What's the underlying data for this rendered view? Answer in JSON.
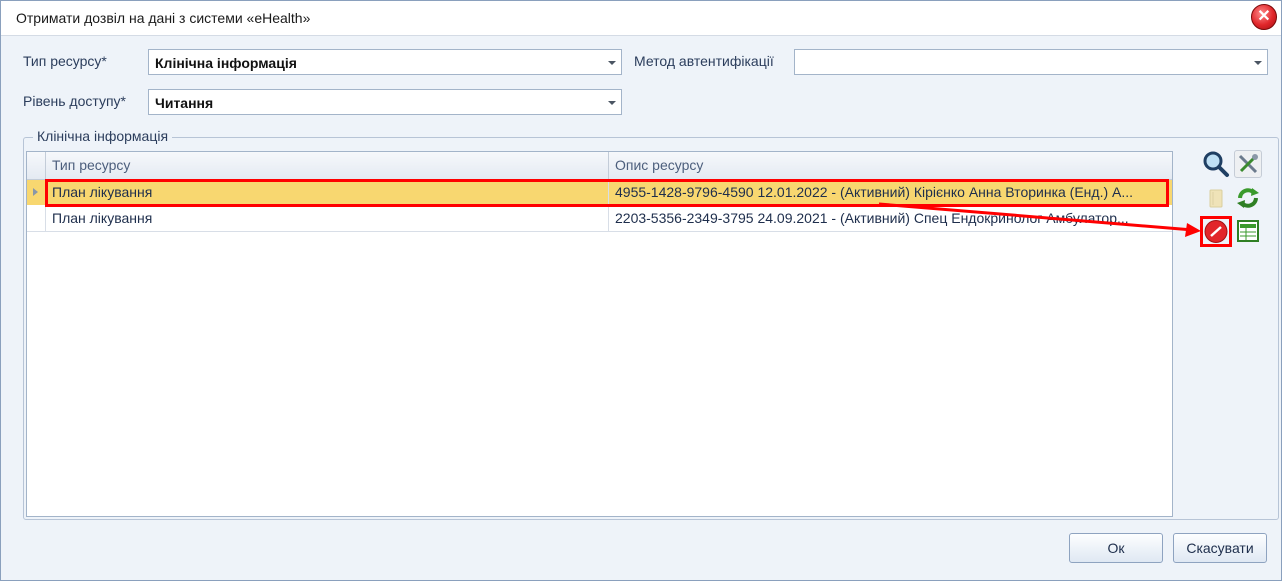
{
  "window": {
    "title": "Отримати дозвіл на дані з системи «eHealth»"
  },
  "form": {
    "resource_type_label": "Тип ресурсу*",
    "resource_type_value": "Клінічна інформація",
    "auth_method_label": "Метод автентифікації",
    "auth_method_value": "",
    "access_level_label": "Рівень доступу*",
    "access_level_value": "Читання"
  },
  "group": {
    "title": "Клінічна інформація"
  },
  "grid": {
    "columns": [
      "Тип ресурсу",
      "Опис ресурсу"
    ],
    "rows": [
      {
        "type": "План лікування",
        "description": "4955-1428-9796-4590 12.01.2022 -  (Активний) Кірієнко Анна Вторинка (Енд.) А...",
        "selected": true
      },
      {
        "type": "План лікування",
        "description": "2203-5356-2349-3795 24.09.2021 -  (Активний) Спец Ендокринолог Амбулатор...",
        "selected": false
      }
    ]
  },
  "toolbar": {
    "icons": [
      "search-icon",
      "tools-icon",
      "book-icon",
      "refresh-icon",
      "cancel-icon",
      "spreadsheet-icon"
    ]
  },
  "buttons": {
    "ok": "Ок",
    "cancel": "Скасувати"
  },
  "colors": {
    "selected_row": "#f8d770",
    "highlight": "#ff0000",
    "close_button": "#e0262a"
  }
}
